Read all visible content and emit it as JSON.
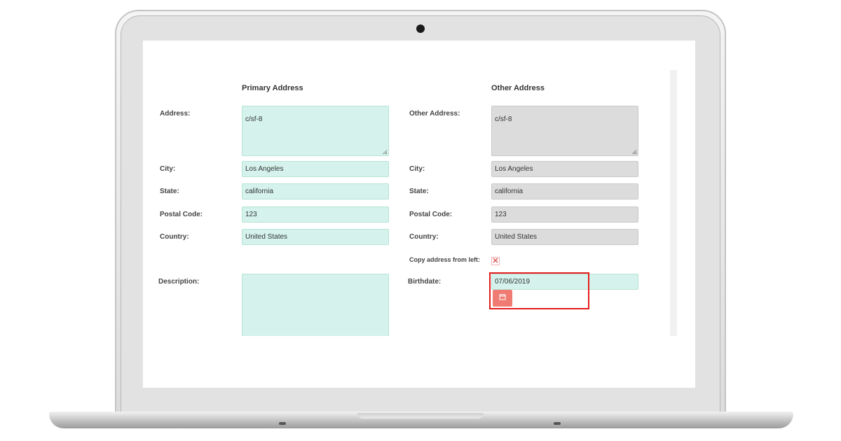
{
  "sections": {
    "primary_title": "Primary Address",
    "other_title": "Other Address"
  },
  "primary": {
    "address_label": "Address:",
    "address_value": "c/sf-8",
    "city_label": "City:",
    "city_value": "Los Angeles",
    "state_label": "State:",
    "state_value": "california",
    "postal_label": "Postal Code:",
    "postal_value": "123",
    "country_label": "Country:",
    "country_value": "United States"
  },
  "other": {
    "address_label": "Other Address:",
    "address_value": "c/sf-8",
    "city_label": "City:",
    "city_value": "Los Angeles",
    "state_label": "State:",
    "state_value": "california",
    "postal_label": "Postal Code:",
    "postal_value": "123",
    "country_label": "Country:",
    "country_value": "United States",
    "copy_label": "Copy address from left:",
    "copy_icon": "close-x-icon"
  },
  "description": {
    "label": "Description:",
    "value": ""
  },
  "birthdate": {
    "label": "Birthdate:",
    "value": "07/06/2019",
    "button_icon": "calendar-icon"
  },
  "colors": {
    "field_bg": "#d5f3ec",
    "disabled_bg": "#dcdcdc",
    "calendar_button": "#ef7b73",
    "highlight": "#e41c1c"
  }
}
